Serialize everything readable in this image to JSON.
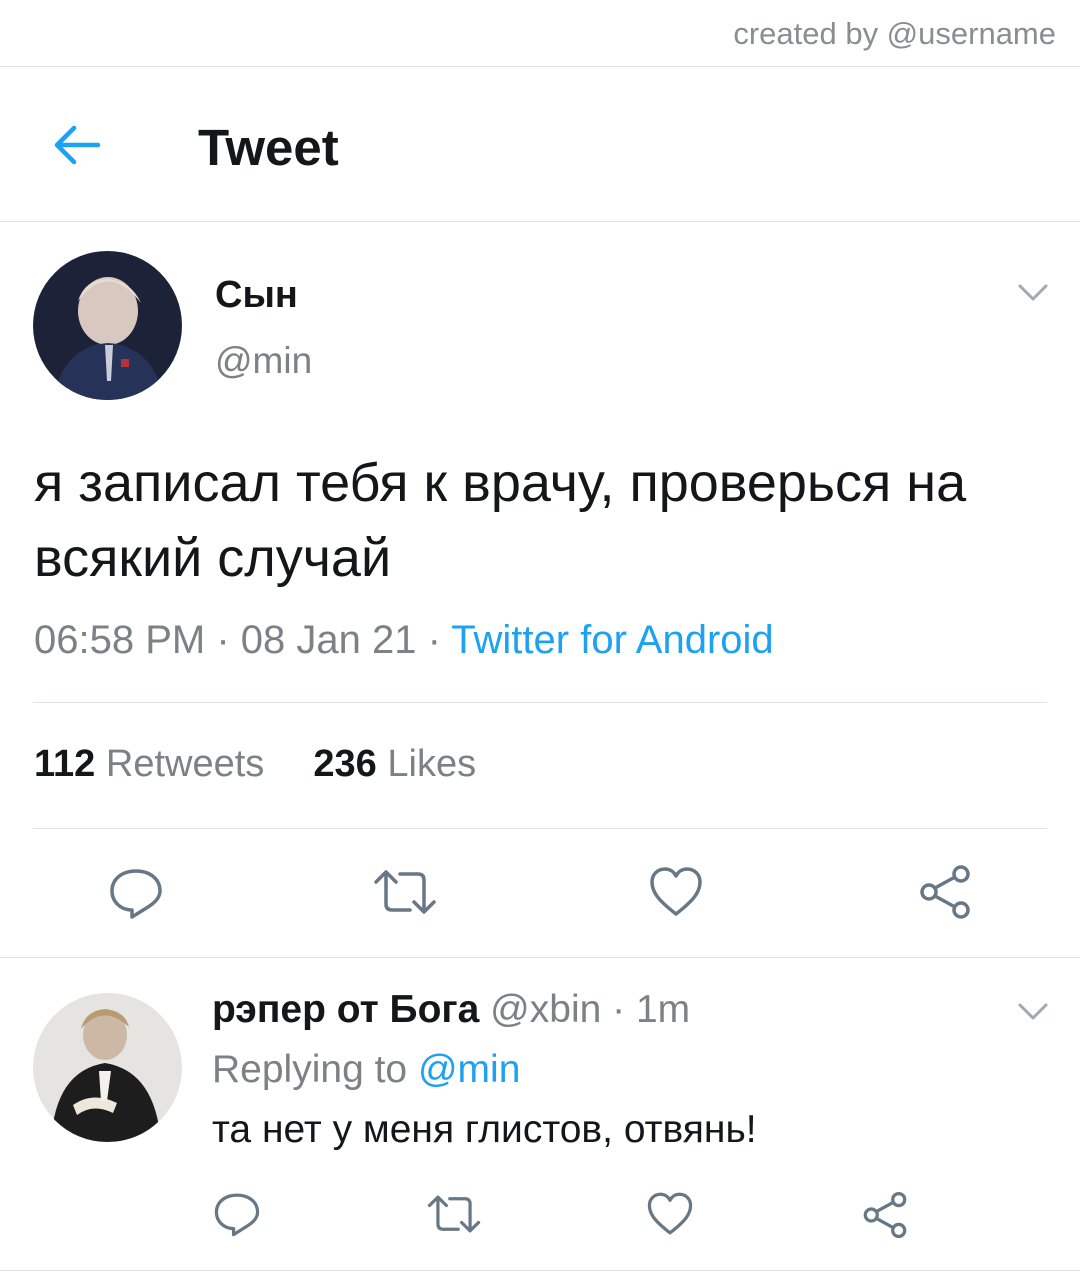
{
  "credit": "created by @username",
  "header": {
    "title": "Tweet"
  },
  "tweet": {
    "author_name": "Сын",
    "author_handle": "@min",
    "text": "я записал тебя к врачу, проверься на всякий случай",
    "time": "06:58 PM",
    "sep1": " · ",
    "date": "08 Jan 21",
    "sep2": " · ",
    "source": "Twitter for Android",
    "retweets_count": "112",
    "retweets_label": "Retweets",
    "likes_count": "236",
    "likes_label": "Likes"
  },
  "reply": {
    "author_name": "рэпер от Бога",
    "author_handle": "@xbin",
    "sep": " · ",
    "age": "1m",
    "replying_prefix": "Replying to ",
    "replying_to": "@min",
    "text": "та нет у меня глистов, отвянь!"
  },
  "icons": [
    "back-arrow-icon",
    "chevron-down-icon",
    "reply-icon",
    "retweet-icon",
    "like-icon",
    "share-icon"
  ],
  "colors": {
    "accent": "#1da1f2",
    "muted": "#7c8186",
    "text": "#14171a",
    "divider": "#dfe3e6"
  }
}
